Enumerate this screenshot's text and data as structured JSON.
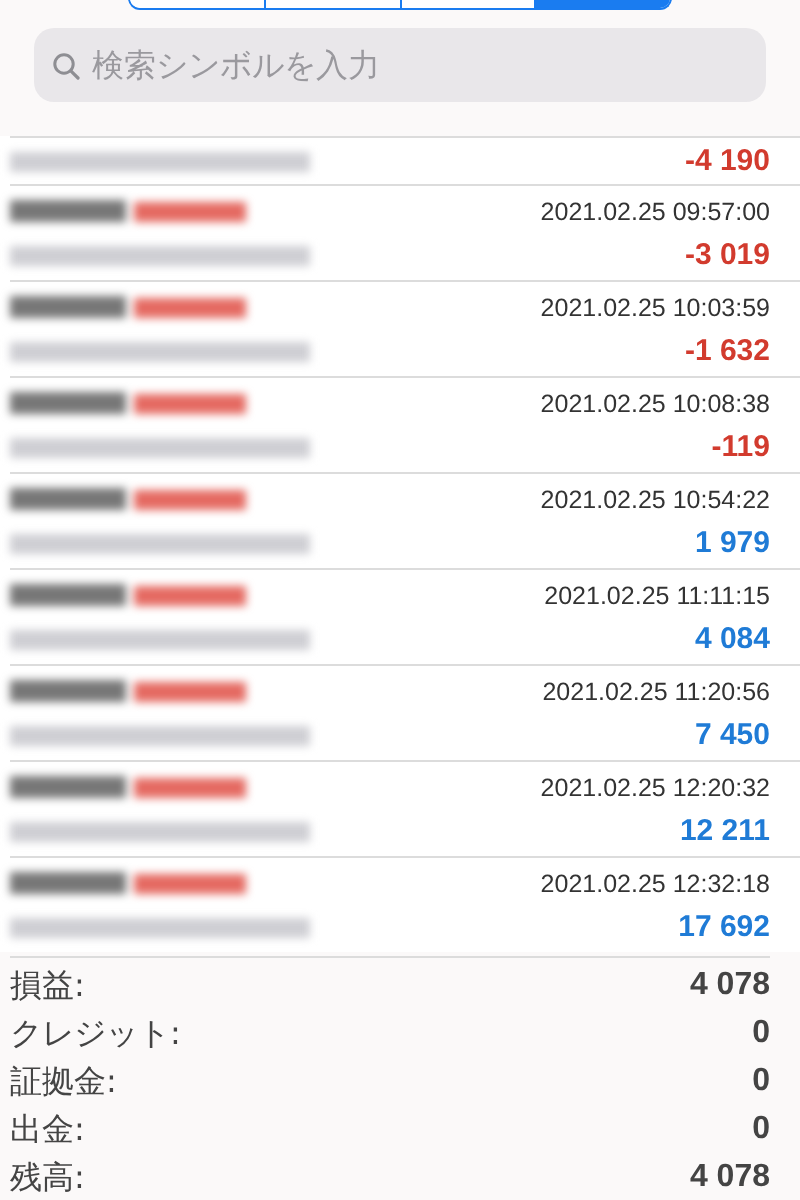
{
  "segments": [
    {
      "selected": false
    },
    {
      "selected": false
    },
    {
      "selected": false
    },
    {
      "selected": true
    }
  ],
  "search": {
    "placeholder": "検索シンボルを入力"
  },
  "trades": [
    {
      "profit": "-4 190",
      "color": "#d23b2e"
    },
    {
      "time": "2021.02.25 09:57:00",
      "profit": "-3 019",
      "color": "#d23b2e"
    },
    {
      "time": "2021.02.25 10:03:59",
      "profit": "-1 632",
      "color": "#d23b2e"
    },
    {
      "time": "2021.02.25 10:08:38",
      "profit": "-119",
      "color": "#d23b2e"
    },
    {
      "time": "2021.02.25 10:54:22",
      "profit": "1 979",
      "color": "#1f7bd6"
    },
    {
      "time": "2021.02.25 11:11:15",
      "profit": "4 084",
      "color": "#1f7bd6"
    },
    {
      "time": "2021.02.25 11:20:56",
      "profit": "7 450",
      "color": "#1f7bd6"
    },
    {
      "time": "2021.02.25 12:20:32",
      "profit": "12 211",
      "color": "#1f7bd6"
    },
    {
      "time": "2021.02.25 12:32:18",
      "profit": "17 692",
      "color": "#1f7bd6"
    }
  ],
  "summary": [
    {
      "label": "損益:",
      "value": "4 078"
    },
    {
      "label": "クレジット:",
      "value": "0"
    },
    {
      "label": "証拠金:",
      "value": "0"
    },
    {
      "label": "出金:",
      "value": "0"
    },
    {
      "label": "残高:",
      "value": "4 078"
    }
  ]
}
